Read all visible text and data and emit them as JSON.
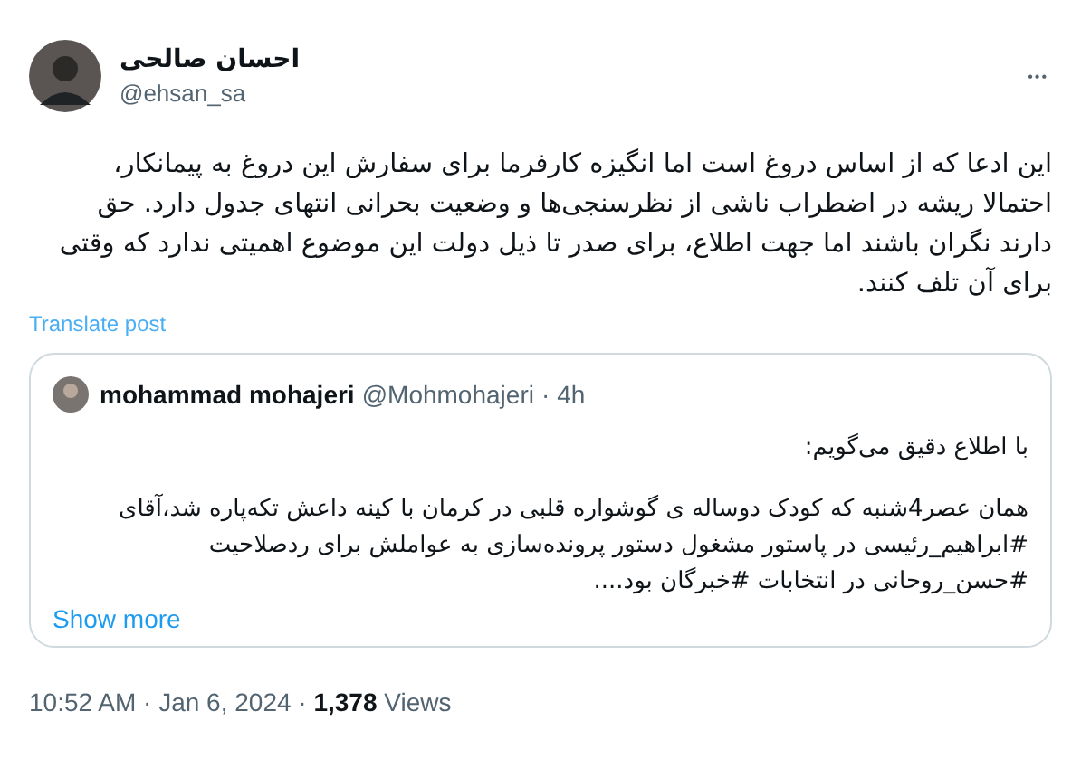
{
  "author": {
    "name": "احسان صالحی",
    "handle": "@ehsan_sa"
  },
  "more": "•••",
  "text": "این ادعا که از اساس دروغ است اما انگیزه کارفرما برای سفارش این دروغ به پیمانکار، احتمالا ریشه در اضطراب ناشی از نظرسنجی‌ها و وضعیت بحرانی انتهای جدول دارد. حق دارند نگران باشند اما جهت اطلاع، برای صدر تا ذیل دولت این موضوع اهمیتی ندارد که وقتی برای آن تلف کنند.",
  "translate": "Translate post",
  "quote": {
    "name": "mohammad mohajeri",
    "handle": "@Mohmohajeri",
    "separator": "·",
    "time": "4h",
    "paragraphs": [
      "با اطلاع دقیق می‌گویم:",
      "همان عصر4شنبه که کودک دوساله ی گوشواره قلبی در کرمان با کینه داعش تکه‌پاره شد،آقای #ابراهیم_رئیسی در پاستور مشغول دستور پرونده‌سازی به عواملش برای ردصلاحیت #حسن_روحانی در انتخابات #خبرگان بود...."
    ],
    "show_more": "Show more"
  },
  "footer": "10:52 AM · Jan 6, 2024 · **1,378** Views"
}
